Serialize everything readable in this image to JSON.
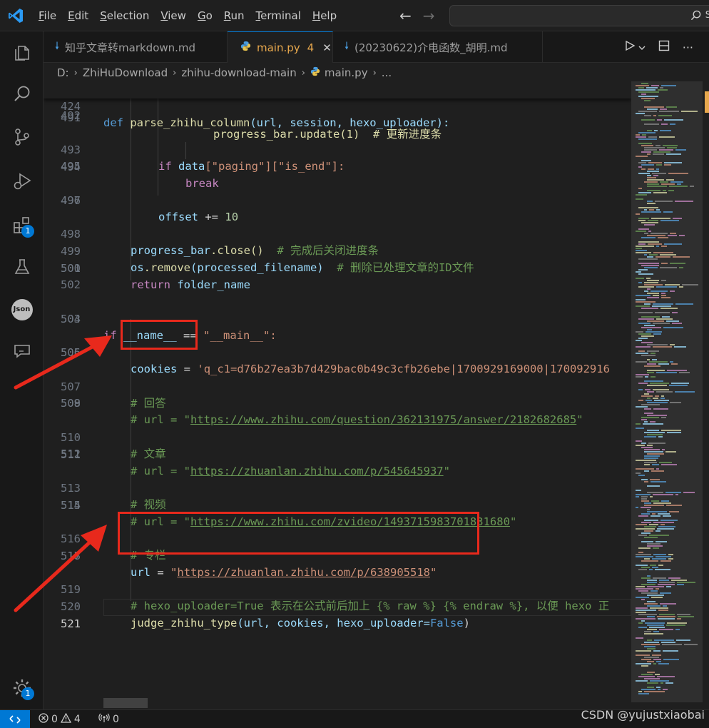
{
  "menu": {
    "items": [
      {
        "label": "File",
        "accel": "F",
        "rest": "ile"
      },
      {
        "label": "Edit",
        "accel": "E",
        "rest": "dit"
      },
      {
        "label": "Selection",
        "accel": "S",
        "rest": "election"
      },
      {
        "label": "View",
        "accel": "V",
        "rest": "iew"
      },
      {
        "label": "Go",
        "accel": "G",
        "rest": "o"
      },
      {
        "label": "Run",
        "accel": "R",
        "rest": "un"
      },
      {
        "label": "Terminal",
        "accel": "T",
        "rest": "erminal"
      },
      {
        "label": "Help",
        "accel": "H",
        "rest": "elp"
      }
    ]
  },
  "search": {
    "text": "S"
  },
  "activity_bar": {
    "items": [
      "explorer-icon",
      "search-icon",
      "source-control-icon",
      "run-debug-icon",
      "extensions-icon",
      "testing-icon",
      "json-icon",
      "comments-icon"
    ],
    "extensions_badge": "1",
    "settings_badge": "1",
    "json_label": "Json"
  },
  "tabs": [
    {
      "label": "知乎文章转markdown.md",
      "icon": "markdown-icon",
      "active": false
    },
    {
      "label": "main.py",
      "icon": "python-icon",
      "active": true,
      "problems": "4"
    },
    {
      "label": "(20230622)介电函数_胡明.md",
      "icon": "markdown-icon",
      "active": false
    }
  ],
  "breadcrumb": {
    "drive": "D:",
    "folder1": "ZhiHuDownload",
    "folder2": "zhihu-download-main",
    "file": "main.py",
    "more": "..."
  },
  "editor": {
    "sticky_line": {
      "num": "424",
      "def": "def",
      "fn": "parse_zhihu_column",
      "args": "(url, session, hexo_uploader):"
    },
    "lines": [
      {
        "n": "491",
        "t": "progress_bar.update(1)  # 更新进度条"
      },
      {
        "n": "492",
        "t": ""
      },
      {
        "n": "493",
        "a": "if",
        "b": "data",
        "c": "[\"paging\"][\"is_end\"]:"
      },
      {
        "n": "494",
        "a": "break"
      },
      {
        "n": "495",
        "t": ""
      },
      {
        "n": "496",
        "a": "offset",
        "b": "+=",
        "c": "10"
      },
      {
        "n": "497",
        "t": ""
      },
      {
        "n": "498",
        "a": "progress_bar",
        "b": ".close()",
        "c": "# 完成后关闭进度条"
      },
      {
        "n": "499",
        "a": "os",
        "b": ".remove",
        "c": "(processed_filename)",
        "d": "# 删除已处理文章的ID文件"
      },
      {
        "n": "500",
        "a": "return",
        "b": "folder_name"
      },
      {
        "n": "501",
        "t": ""
      },
      {
        "n": "502",
        "t": ""
      },
      {
        "n": "503",
        "a": "if",
        "b": "__name__",
        "c": "==",
        "d": "\"__main__\":"
      },
      {
        "n": "504",
        "t": ""
      },
      {
        "n": "505",
        "a": "cookies",
        "b": "=",
        "c": "'q_c1=d76b27ea3b7d429bac0b49c3cfb26ebe|1700929169000|170092916"
      },
      {
        "n": "506",
        "t": ""
      },
      {
        "n": "507",
        "t": "# 回答"
      },
      {
        "n": "508",
        "a": "# url = \"",
        "b": "https://www.zhihu.com/question/362131975/answer/2182682685",
        "c": "\""
      },
      {
        "n": "509",
        "t": ""
      },
      {
        "n": "510",
        "t": "# 文章"
      },
      {
        "n": "511",
        "a": "# url = \"",
        "b": "https://zhuanlan.zhihu.com/p/545645937",
        "c": "\""
      },
      {
        "n": "512",
        "t": ""
      },
      {
        "n": "513",
        "t": "# 视频"
      },
      {
        "n": "514",
        "a": "# url = \"",
        "b": "https://www.zhihu.com/zvideo/1493715983701831680",
        "c": "\""
      },
      {
        "n": "515",
        "t": ""
      },
      {
        "n": "516",
        "t": "# 专栏"
      },
      {
        "n": "517",
        "a": "url",
        "b": "=",
        "c": "\"",
        "d": "https://zhuanlan.zhihu.com/p/638905518",
        "e": "\""
      },
      {
        "n": "518",
        "t": ""
      },
      {
        "n": "519",
        "t": "# hexo_uploader=True 表示在公式前后加上 {% raw %} {% endraw %}, 以便 hexo 正"
      },
      {
        "n": "520",
        "a": "judge_zhihu_type",
        "b": "(url, cookies, hexo_uploader=",
        "c": "False",
        "d": ")"
      },
      {
        "n": "521",
        "t": ""
      }
    ]
  },
  "status": {
    "errors": "0",
    "warnings": "4",
    "ports": "0"
  },
  "watermark": "CSDN @yujustxiaobai",
  "colors": {
    "accent": "#0078d4",
    "annotation": "#e8291c",
    "modified": "#e8a84d"
  }
}
